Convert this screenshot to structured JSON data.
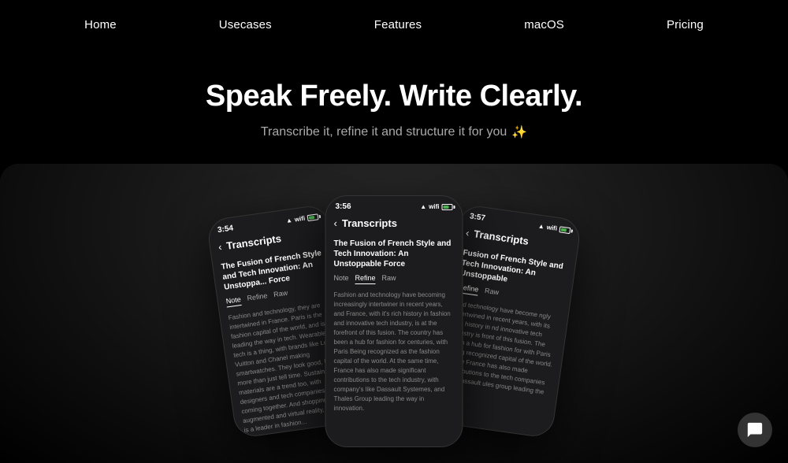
{
  "nav": {
    "items": [
      {
        "label": "Home",
        "id": "home"
      },
      {
        "label": "Usecases",
        "id": "usecases"
      },
      {
        "label": "Features",
        "id": "features"
      },
      {
        "label": "macOS",
        "id": "macos"
      },
      {
        "label": "Pricing",
        "id": "pricing"
      }
    ]
  },
  "hero": {
    "title": "Speak Freely. Write Clearly.",
    "subtitle": "Transcribe it, refine it and structure it for you",
    "sparkle": "✨"
  },
  "phones": {
    "left": {
      "time": "3:54",
      "header": "Transcripts",
      "article_title": "The Fusion of French Style and Tech Innovation: An Unstoppa... Force",
      "tabs": [
        "Note",
        "Refine",
        "Raw"
      ],
      "active_tab": "Note",
      "body": "Fashion and technology, they are intertwined in France. Paris is the fashion capital of the world, and is leading the way in tech. Wearable tech is a thing, with brands like Louis Vuitton and Chanel making smartwatches. They look good, but more than just tell time. Sustainability materials are a trend too, with designers and tech companies coming together. And shopping? It's augmented and virtual reality, France is a leader in fashion..."
    },
    "center": {
      "time": "3:56",
      "header": "Transcripts",
      "article_title": "The Fusion of French Style and Tech Innovation: An Unstoppable Force",
      "tabs": [
        "Note",
        "Refine",
        "Raw"
      ],
      "active_tab": "Refine",
      "body": "Fashion and technology have becoming increasingly intertwiner in recent years, and France, with it's rich history in fashion and innovative tech industry, is at the forefront of this fusion. The country has been a hub for fashion for centuries, with Paris Being recognized as the fashion capital of the world. At the same time, France has also made significant contributions to the tech industry, with company's like Dassault Systemes, and Thales Group leading the way in innovation."
    },
    "right": {
      "time": "3:57",
      "header": "Transcripts",
      "article_title": "Fusion of French Style and Tech Innovation: An Unstoppable",
      "tabs": [
        "Refine",
        "Raw"
      ],
      "active_tab": "Refine",
      "body": "and technology have become ngly intertwined in recent years, with its rich history in nd innovative tech industry is front of this fusion. The been a hub for fashion for with Paris being recognized capital of the world. At the France has also made contributions to the tech companies like Dassault ules group leading the way..."
    }
  },
  "chat": {
    "icon": "💬"
  }
}
